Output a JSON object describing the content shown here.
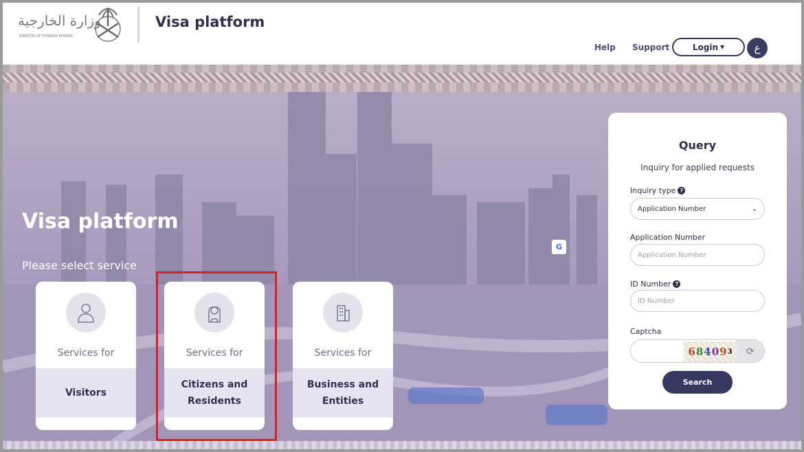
{
  "header": {
    "logo_text": "وزارة الخارجية",
    "logo_subtext": "MINISTRY OF FOREIGN AFFAIRS",
    "app_title": "Visa platform",
    "nav": {
      "help": "Help",
      "support": "Support"
    },
    "login_label": "Login",
    "language_label": "ع"
  },
  "hero": {
    "title": "Visa platform",
    "subtitle": "Please select service"
  },
  "services": [
    {
      "prefix": "Services for",
      "name": "Visitors",
      "icon": "person-icon"
    },
    {
      "prefix": "Services for",
      "name": "Citizens and\nResidents",
      "icon": "citizen-icon"
    },
    {
      "prefix": "Services for",
      "name": "Business and\nEntities",
      "icon": "building-icon"
    }
  ],
  "query": {
    "title": "Query",
    "subtitle": "Inquiry for applied requests",
    "inquiry_type_label": "Inquiry type",
    "inquiry_type_value": "Application Number",
    "application_number_label": "Application Number",
    "application_number_placeholder": "Application Number",
    "id_number_label": "ID Number",
    "id_number_placeholder": "ID Number",
    "captcha_label": "Captcha",
    "captcha_chars": [
      "6",
      "8",
      "4",
      "0",
      "9",
      "3"
    ],
    "search_label": "Search"
  },
  "colors": {
    "primary": "#353861",
    "highlight": "#e01b22",
    "card_band": "#e7e4f2"
  }
}
